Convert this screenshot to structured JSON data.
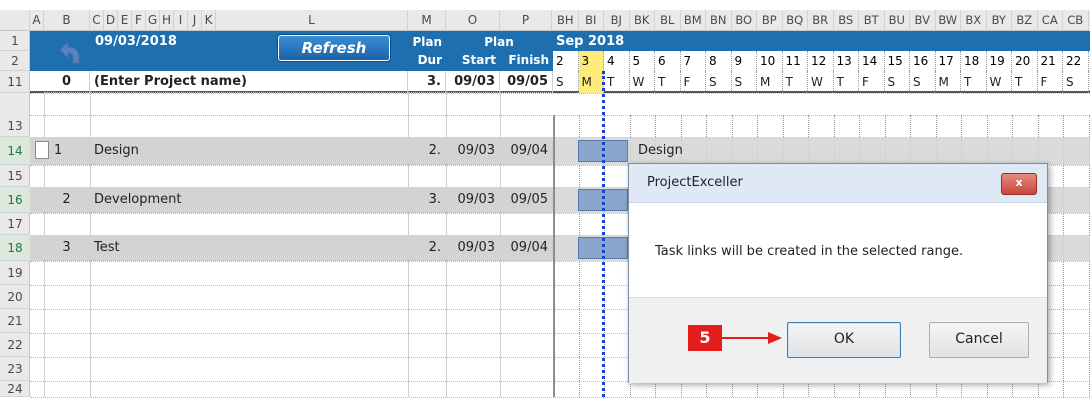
{
  "columns": {
    "left": [
      "A",
      "B",
      "C",
      "D",
      "E",
      "F",
      "G",
      "H",
      "I",
      "J",
      "K",
      "L",
      "M",
      "O",
      "P"
    ],
    "gantt": [
      "BH",
      "BI",
      "BJ",
      "BK",
      "BL",
      "BM",
      "BN",
      "BO",
      "BP",
      "BQ",
      "BR",
      "BS",
      "BT",
      "BU",
      "BV",
      "BW",
      "BX",
      "BY",
      "BZ",
      "CA",
      "CB"
    ]
  },
  "rows": [
    "1",
    "2",
    "11",
    "13",
    "14",
    "15",
    "16",
    "17",
    "18",
    "19",
    "20",
    "21",
    "22",
    "23",
    "24"
  ],
  "header": {
    "date": "09/03/2018",
    "refresh_label": "Refresh",
    "plan_dur": [
      "Plan",
      "Dur"
    ],
    "plan_start_finish": [
      "Plan",
      "Start",
      "Finish"
    ],
    "month": "Sep 2018",
    "days": [
      "2",
      "3",
      "4",
      "5",
      "6",
      "7",
      "8",
      "9",
      "10",
      "11",
      "12",
      "13",
      "14",
      "15",
      "16",
      "17",
      "18",
      "19",
      "20",
      "21",
      "22"
    ],
    "weekdays": [
      "S",
      "M",
      "T",
      "W",
      "T",
      "F",
      "S",
      "S",
      "M",
      "T",
      "W",
      "T",
      "F",
      "S",
      "S",
      "M",
      "T",
      "W",
      "T",
      "F",
      "S"
    ]
  },
  "project": {
    "id": "0",
    "name": "(Enter Project name)",
    "dur": "3.",
    "start": "09/03",
    "finish": "09/05"
  },
  "tasks": [
    {
      "id": "1",
      "name": "Design",
      "dur": "2.",
      "start": "09/03",
      "finish": "09/04"
    },
    {
      "id": "2",
      "name": "Development",
      "dur": "3.",
      "start": "09/03",
      "finish": "09/05"
    },
    {
      "id": "3",
      "name": "Test",
      "dur": "2.",
      "start": "09/03",
      "finish": "09/04"
    }
  ],
  "gantt_bar_label": "Design",
  "dialog": {
    "title": "ProjectExceller",
    "close": "x",
    "message": "Task links will be created in the selected range.",
    "ok": "OK",
    "cancel": "Cancel"
  },
  "step_marker": "5",
  "colors": {
    "header_blue": "#1e6fb0",
    "today_line": "#1a3fd1",
    "today_highlight": "#ffeb7a",
    "marker_red": "#e31d1d"
  }
}
